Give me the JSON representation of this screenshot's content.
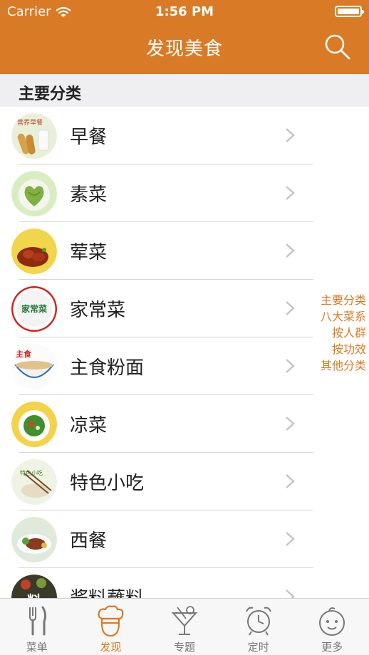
{
  "status_bar": {
    "carrier": "Carrier",
    "time": "1:56 PM"
  },
  "nav": {
    "title": "发现美食",
    "search_icon": "search-icon"
  },
  "section": {
    "title": "主要分类"
  },
  "categories": [
    {
      "label": "早餐",
      "icon": "breakfast-thumbnail"
    },
    {
      "label": "素菜",
      "icon": "vegetable-dish-thumbnail"
    },
    {
      "label": "荤菜",
      "icon": "meat-dish-thumbnail"
    },
    {
      "label": "家常菜",
      "icon": "home-cooking-thumbnail"
    },
    {
      "label": "主食粉面",
      "icon": "staple-noodles-thumbnail"
    },
    {
      "label": "凉菜",
      "icon": "cold-dish-thumbnail"
    },
    {
      "label": "特色小吃",
      "icon": "snacks-thumbnail"
    },
    {
      "label": "西餐",
      "icon": "western-food-thumbnail"
    },
    {
      "label": "酱料蘸料",
      "icon": "sauces-thumbnail"
    }
  ],
  "thumb_texts": {
    "breakfast": "营养早餐",
    "home": "家常菜",
    "staple": "主食",
    "snack": "特色小吃",
    "sauce": "料"
  },
  "side_index": [
    "主要分类",
    "八大菜系",
    "按人群",
    "按功效",
    "其他分类"
  ],
  "tabs": [
    {
      "label": "菜单",
      "icon": "fork-knife-icon",
      "active": false
    },
    {
      "label": "发现",
      "icon": "chef-hat-icon",
      "active": true
    },
    {
      "label": "专题",
      "icon": "cocktail-icon",
      "active": false
    },
    {
      "label": "定时",
      "icon": "alarm-clock-icon",
      "active": false
    },
    {
      "label": "更多",
      "icon": "baby-face-icon",
      "active": false
    }
  ],
  "colors": {
    "accent": "#d97b26",
    "section_bg": "#efeff1",
    "separator": "#d6d6d6"
  }
}
